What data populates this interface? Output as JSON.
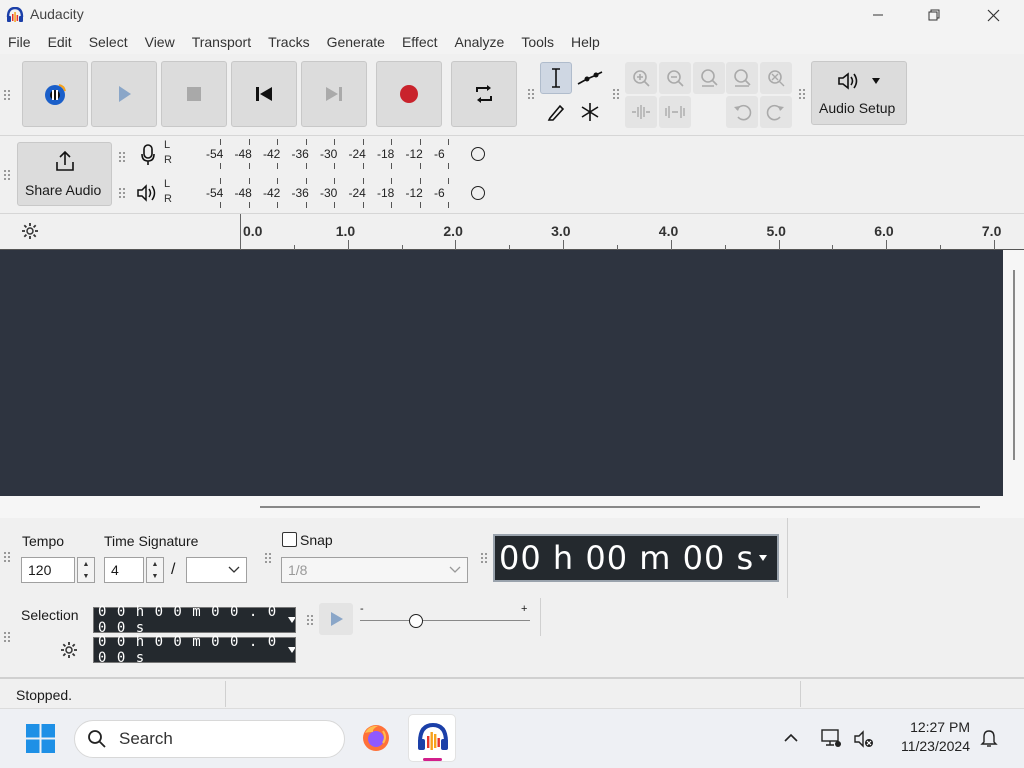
{
  "window": {
    "title": "Audacity"
  },
  "menu": [
    "File",
    "Edit",
    "Select",
    "View",
    "Transport",
    "Tracks",
    "Generate",
    "Effect",
    "Analyze",
    "Tools",
    "Help"
  ],
  "toolbar": {
    "audio_setup_label": "Audio Setup"
  },
  "share": {
    "label": "Share Audio"
  },
  "meters": {
    "channel_l": "L",
    "channel_r": "R",
    "scale": [
      "-54",
      "-48",
      "-42",
      "-36",
      "-30",
      "-24",
      "-18",
      "-12",
      "-6"
    ]
  },
  "ruler": {
    "labels": [
      "0.0",
      "1.0",
      "2.0",
      "3.0",
      "4.0",
      "5.0",
      "6.0",
      "7.0"
    ]
  },
  "tempo": {
    "label": "Tempo",
    "value": "120"
  },
  "time_signature": {
    "label": "Time Signature",
    "numerator": "4",
    "separator": "/",
    "denominator": ""
  },
  "snap": {
    "label": "Snap",
    "value": "1/8",
    "checked": false
  },
  "time_display": {
    "value": "00 h 00 m 00 s"
  },
  "selection": {
    "label": "Selection",
    "start": "0 0 h 0 0 m 0 0 . 0 0 0 s",
    "end": "0 0 h 0 0 m 0 0 . 0 0 0 s"
  },
  "playback_speed": {
    "min_label": "-",
    "max_label": "+",
    "level": 0.33
  },
  "status": {
    "text": "Stopped."
  },
  "taskbar": {
    "search_placeholder": "Search",
    "time": "12:27 PM",
    "date": "11/23/2024"
  },
  "colors": {
    "track_bg": "#2e3440",
    "record_red": "#c9232c",
    "audacity_orange": "#f7a21b",
    "audacity_blue": "#1b5fc9"
  }
}
